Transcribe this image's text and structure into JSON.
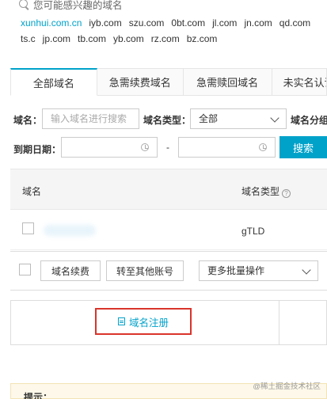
{
  "suggestion": {
    "title": "您可能感兴趣的域名",
    "domains": [
      "xunhui.com.cn",
      "iyb.com",
      "szu.com",
      "0bt.com",
      "jl.com",
      "jn.com",
      "qd.com",
      "ts.c",
      "jp.com",
      "tb.com",
      "yb.com",
      "rz.com",
      "bz.com"
    ]
  },
  "tabs": [
    "全部域名",
    "急需续费域名",
    "急需赎回域名",
    "未实名认证"
  ],
  "filters": {
    "domain_label": "域名：",
    "domain_placeholder": "输入域名进行搜索",
    "type_label": "域名类型：",
    "type_value": "全部",
    "group_label": "域名分组",
    "expire_label": "到期日期：",
    "range_sep": "-",
    "search_button": "搜索"
  },
  "table": {
    "columns": [
      "域名",
      "域名类型"
    ],
    "rows": [
      {
        "domain": "",
        "type": "gTLD"
      }
    ]
  },
  "batch": {
    "renew_button": "域名续费",
    "transfer_button": "转至其他账号",
    "more_select": "更多批量操作"
  },
  "register_button": "域名注册",
  "tip_label": "提示：",
  "watermark": "@稀土掘金技术社区"
}
